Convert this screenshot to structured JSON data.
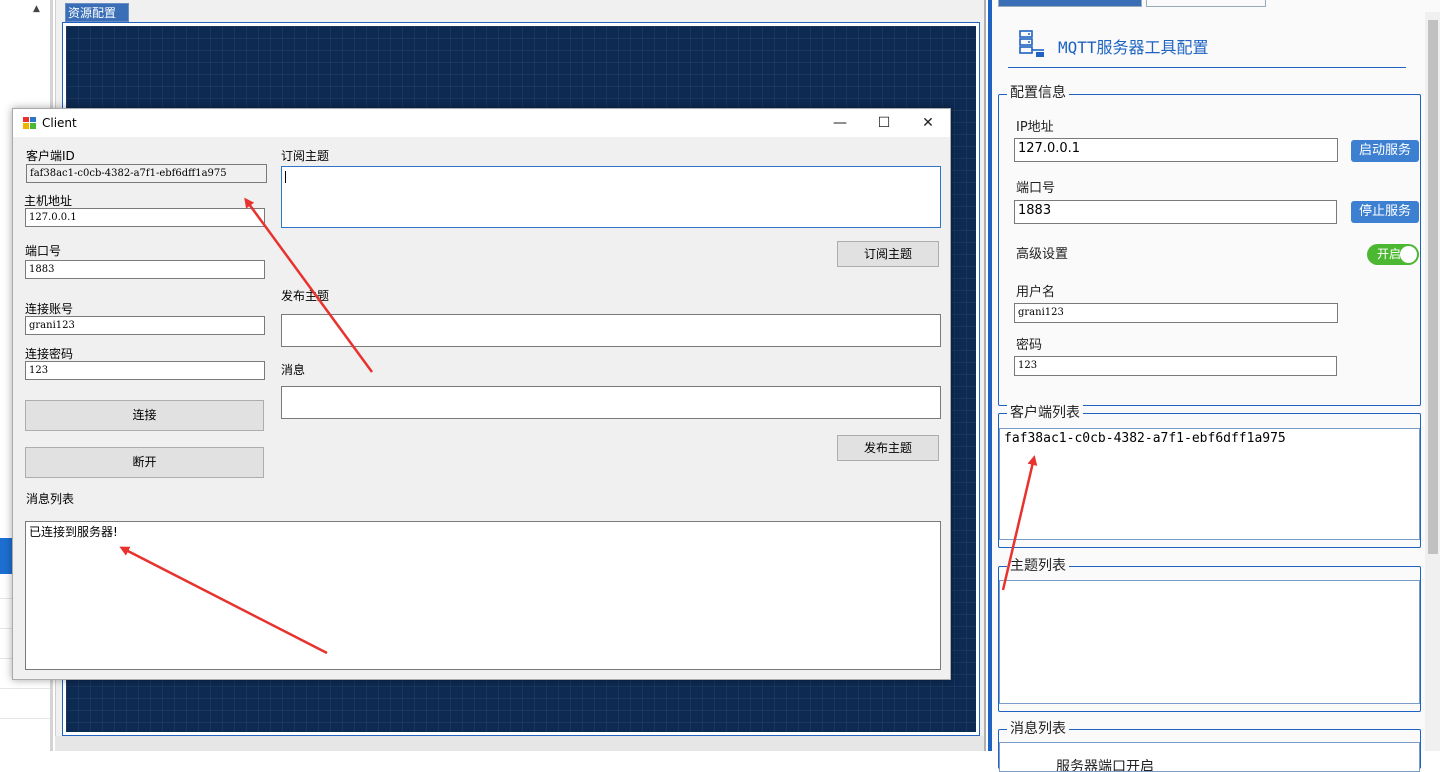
{
  "designer": {
    "tab_label": "资源配置"
  },
  "config_panel": {
    "title": "MQTT服务器工具配置",
    "group_config": "配置信息",
    "ip_label": "IP地址",
    "ip_value": "127.0.0.1",
    "start_button": "启动服务",
    "port_label": "端口号",
    "port_value": "1883",
    "stop_button": "停止服务",
    "advanced_label": "高级设置",
    "toggle_label": "开启",
    "toggle_on": true,
    "username_label": "用户名",
    "username_value": "grani123",
    "password_label": "密码",
    "password_value": "123",
    "group_clients": "客户端列表",
    "clients": [
      "faf38ac1-c0cb-4382-a7f1-ebf6dff1a975"
    ],
    "group_topics": "主题列表",
    "group_messages": "消息列表",
    "messages_partial": "服务器端口开启"
  },
  "client_window": {
    "title": "Client",
    "client_id_label": "客户端ID",
    "client_id_value": "faf38ac1-c0cb-4382-a7f1-ebf6dff1a975",
    "host_label": "主机地址",
    "host_value": "127.0.0.1",
    "port_label": "端口号",
    "port_value": "1883",
    "account_label": "连接账号",
    "account_value": "grani123",
    "password_label": "连接密码",
    "password_value": "123",
    "connect_button": "连接",
    "disconnect_button": "断开",
    "message_list_label": "消息列表",
    "message_list_text": "已连接到服务器!",
    "subscribe_topic_label": "订阅主题",
    "subscribe_button": "订阅主题",
    "publish_topic_label": "发布主题",
    "message_label": "消息",
    "publish_button": "发布主题",
    "minimize_glyph": "—",
    "maximize_glyph": "☐",
    "close_glyph": "✕"
  },
  "colors": {
    "accent": "#1e63c2",
    "toggle_on": "#4cb831",
    "arrow": "#e8322d",
    "canvas": "#0d2a52"
  }
}
